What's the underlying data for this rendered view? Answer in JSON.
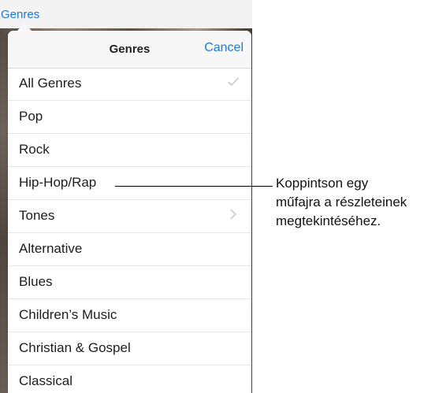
{
  "topbar": {
    "label": "Genres"
  },
  "popover": {
    "title": "Genres",
    "cancel_label": "Cancel",
    "items": [
      {
        "label": "All Genres",
        "accessory": "checkmark-icon"
      },
      {
        "label": "Pop",
        "accessory": ""
      },
      {
        "label": "Rock",
        "accessory": ""
      },
      {
        "label": "Hip-Hop/Rap",
        "accessory": ""
      },
      {
        "label": "Tones",
        "accessory": "chevron-right-icon"
      },
      {
        "label": "Alternative",
        "accessory": ""
      },
      {
        "label": "Blues",
        "accessory": ""
      },
      {
        "label": "Children’s Music",
        "accessory": ""
      },
      {
        "label": "Christian & Gospel",
        "accessory": ""
      },
      {
        "label": "Classical",
        "accessory": ""
      }
    ]
  },
  "annotation": {
    "lines": [
      "Koppintson egy",
      "műfajra a részleteinek",
      "megtekintéséhez."
    ]
  },
  "colors": {
    "accent": "#1e78d6",
    "panel": "#ffffff",
    "header": "#f7f7f7",
    "separator": "#e6e6e6",
    "text": "#1c1c1c"
  }
}
